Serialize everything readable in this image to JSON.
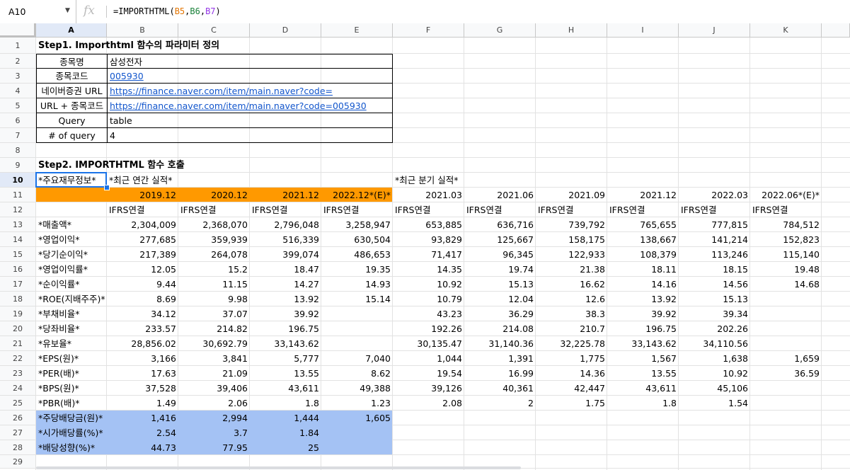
{
  "namebox": {
    "value": "A10"
  },
  "formula_bar": {
    "fx_symbol": "fx",
    "prefix": "=IMPORTHTML(",
    "ref1": "B5",
    "comma1": ",",
    "ref2": "B6",
    "comma2": ",",
    "ref3": "B7",
    "suffix": ")"
  },
  "columns": [
    "A",
    "B",
    "C",
    "D",
    "E",
    "F",
    "G",
    "H",
    "I",
    "J",
    "K"
  ],
  "rows": [
    "1",
    "2",
    "3",
    "4",
    "5",
    "6",
    "7",
    "8",
    "9",
    "10",
    "11",
    "12",
    "13",
    "14",
    "15",
    "16",
    "17",
    "18",
    "19",
    "20",
    "21",
    "22",
    "23",
    "24",
    "25",
    "26",
    "27",
    "28",
    "29"
  ],
  "step1": {
    "title": "Step1. Importhtml 함수의 파라미터 정의",
    "params": [
      {
        "label": "종목명",
        "value": "삼성전자",
        "link": false
      },
      {
        "label": "종목코드",
        "value": "005930",
        "link": true
      },
      {
        "label": "네이버증권 URL",
        "value": "https://finance.naver.com/item/main.naver?code=",
        "link": true
      },
      {
        "label": "URL + 종목코드",
        "value": "https://finance.naver.com/item/main.naver?code=005930",
        "link": true
      },
      {
        "label": "Query",
        "value": "table",
        "link": false
      },
      {
        "label": "# of query",
        "value": "4",
        "link": false
      }
    ]
  },
  "step2": {
    "title": "Step2. IMPORTHTML 함수 호출",
    "header_a": "*주요재무정보*",
    "annual_label": "*최근 연간 실적*",
    "quarterly_label": "*최근 분기 실적*",
    "periods": [
      "2019.12",
      "2020.12",
      "2021.12",
      "2022.12*(E)*",
      "2021.03",
      "2021.06",
      "2021.09",
      "2021.12",
      "2022.03",
      "2022.06*(E)*"
    ],
    "standards": [
      "IFRS연결",
      "IFRS연결",
      "IFRS연결",
      "IFRS연결",
      "IFRS연결",
      "IFRS연결",
      "IFRS연결",
      "IFRS연결",
      "IFRS연결",
      "IFRS연결"
    ],
    "table": [
      {
        "label": "*매출액*",
        "values": [
          "2,304,009",
          "2,368,070",
          "2,796,048",
          "3,258,947",
          "653,885",
          "636,716",
          "739,792",
          "765,655",
          "777,815",
          "784,512"
        ]
      },
      {
        "label": "*영업이익*",
        "values": [
          "277,685",
          "359,939",
          "516,339",
          "630,504",
          "93,829",
          "125,667",
          "158,175",
          "138,667",
          "141,214",
          "152,823"
        ]
      },
      {
        "label": "*당기순이익*",
        "values": [
          "217,389",
          "264,078",
          "399,074",
          "486,653",
          "71,417",
          "96,345",
          "122,933",
          "108,379",
          "113,246",
          "115,140"
        ]
      },
      {
        "label": "*영업이익률*",
        "values": [
          "12.05",
          "15.2",
          "18.47",
          "19.35",
          "14.35",
          "19.74",
          "21.38",
          "18.11",
          "18.15",
          "19.48"
        ]
      },
      {
        "label": "*순이익률*",
        "values": [
          "9.44",
          "11.15",
          "14.27",
          "14.93",
          "10.92",
          "15.13",
          "16.62",
          "14.16",
          "14.56",
          "14.68"
        ]
      },
      {
        "label": "*ROE(지배주주)*",
        "values": [
          "8.69",
          "9.98",
          "13.92",
          "15.14",
          "10.79",
          "12.04",
          "12.6",
          "13.92",
          "15.13",
          ""
        ]
      },
      {
        "label": "*부채비율*",
        "values": [
          "34.12",
          "37.07",
          "39.92",
          "",
          "43.23",
          "36.29",
          "38.3",
          "39.92",
          "39.34",
          ""
        ]
      },
      {
        "label": "*당좌비율*",
        "values": [
          "233.57",
          "214.82",
          "196.75",
          "",
          "192.26",
          "214.08",
          "210.7",
          "196.75",
          "202.26",
          ""
        ]
      },
      {
        "label": "*유보율*",
        "values": [
          "28,856.02",
          "30,692.79",
          "33,143.62",
          "",
          "30,135.47",
          "31,140.36",
          "32,225.78",
          "33,143.62",
          "34,110.56",
          ""
        ]
      },
      {
        "label": "*EPS(원)*",
        "values": [
          "3,166",
          "3,841",
          "5,777",
          "7,040",
          "1,044",
          "1,391",
          "1,775",
          "1,567",
          "1,638",
          "1,659"
        ]
      },
      {
        "label": "*PER(배)*",
        "values": [
          "17.63",
          "21.09",
          "13.55",
          "8.62",
          "19.54",
          "16.99",
          "14.36",
          "13.55",
          "10.92",
          "36.59"
        ]
      },
      {
        "label": "*BPS(원)*",
        "values": [
          "37,528",
          "39,406",
          "43,611",
          "49,388",
          "39,126",
          "40,361",
          "42,447",
          "43,611",
          "45,106",
          ""
        ]
      },
      {
        "label": "*PBR(배)*",
        "values": [
          "1.49",
          "2.06",
          "1.8",
          "1.23",
          "2.08",
          "2",
          "1.75",
          "1.8",
          "1.54",
          ""
        ]
      },
      {
        "label": "*주당배당금(원)*",
        "values": [
          "1,416",
          "2,994",
          "1,444",
          "1,605",
          "",
          "",
          "",
          "",
          "",
          ""
        ]
      },
      {
        "label": "*시가배당률(%)*",
        "values": [
          "2.54",
          "3.7",
          "1.84",
          "",
          "",
          "",
          "",
          "",
          "",
          ""
        ]
      },
      {
        "label": "*배당성향(%)*",
        "values": [
          "44.73",
          "77.95",
          "25",
          "",
          "",
          "",
          "",
          "",
          "",
          ""
        ]
      }
    ]
  },
  "colors": {
    "orange": "#ff9900",
    "blue": "#a4c2f4",
    "link": "#1155cc",
    "selection": "#1a73e8"
  }
}
